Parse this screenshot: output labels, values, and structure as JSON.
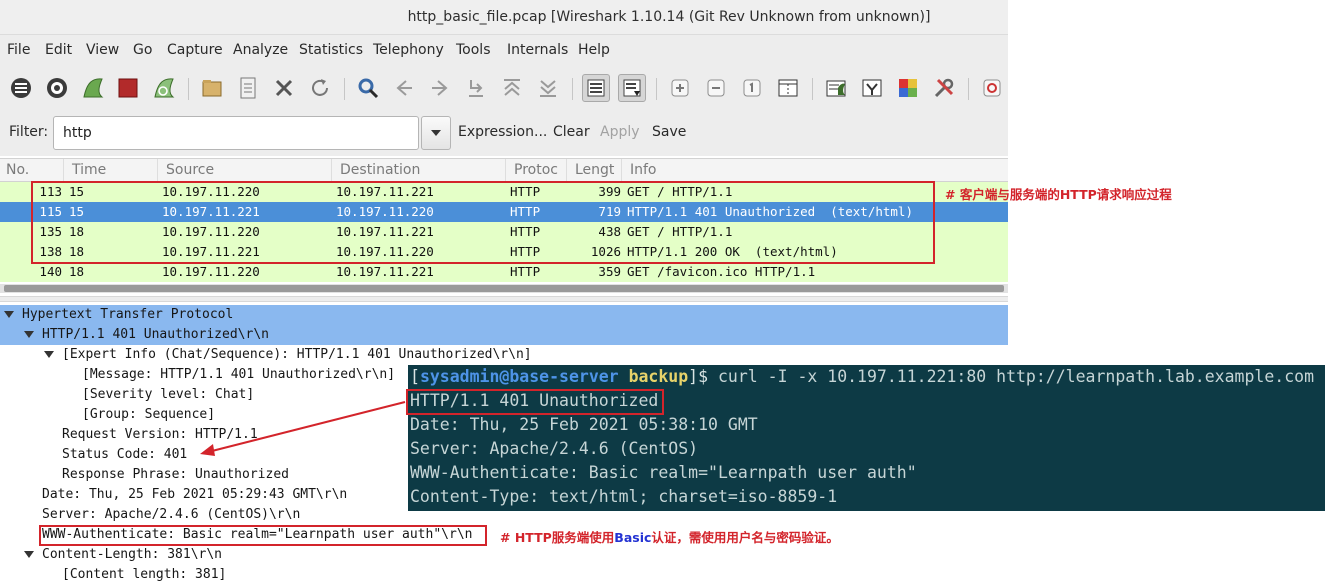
{
  "window": {
    "title": "http_basic_file.pcap  [Wireshark 1.10.14  (Git Rev Unknown from unknown)]"
  },
  "menu": [
    "File",
    "Edit",
    "View",
    "Go",
    "Capture",
    "Analyze",
    "Statistics",
    "Telephony",
    "Tools",
    "Internals",
    "Help"
  ],
  "toolbar": {
    "icons": [
      "interfaces-icon",
      "options-icon",
      "start-capture-icon",
      "stop-capture-icon",
      "restart-capture-icon",
      "open-icon",
      "save-icon",
      "close-icon",
      "reload-icon",
      "find-icon",
      "back-icon",
      "forward-icon",
      "goto-icon",
      "first-icon",
      "last-icon",
      "colorize-icon",
      "autoscroll-icon",
      "zoom-in-icon",
      "zoom-out-icon",
      "normal-size-icon",
      "resize-columns-icon",
      "capture-filters-icon",
      "display-filters-icon",
      "coloring-rules-icon",
      "preferences-icon",
      "help-icon"
    ]
  },
  "filter": {
    "label": "Filter:",
    "value": "http",
    "buttons": {
      "expression": "Expression...",
      "clear": "Clear",
      "apply": "Apply",
      "save": "Save"
    }
  },
  "packet_list": {
    "columns": [
      "No.",
      "Time",
      "Source",
      "Destination",
      "Protocol",
      "Length",
      "Info"
    ],
    "column_display": [
      "No.",
      "Time",
      "Source",
      "Destination",
      "Protoc",
      "Lengt",
      "Info"
    ],
    "rows": [
      {
        "no": "113",
        "time": "15",
        "src": "10.197.11.220",
        "dst": "10.197.11.221",
        "proto": "HTTP",
        "len": "399",
        "info": "GET / HTTP/1.1",
        "selected": false
      },
      {
        "no": "115",
        "time": "15",
        "src": "10.197.11.221",
        "dst": "10.197.11.220",
        "proto": "HTTP",
        "len": "719",
        "info": "HTTP/1.1 401 Unauthorized  (text/html)",
        "selected": true
      },
      {
        "no": "135",
        "time": "18",
        "src": "10.197.11.220",
        "dst": "10.197.11.221",
        "proto": "HTTP",
        "len": "438",
        "info": "GET / HTTP/1.1",
        "selected": false
      },
      {
        "no": "138",
        "time": "18",
        "src": "10.197.11.221",
        "dst": "10.197.11.220",
        "proto": "HTTP",
        "len": "1026",
        "info": "HTTP/1.1 200 OK  (text/html)",
        "selected": false
      },
      {
        "no": "140",
        "time": "18",
        "src": "10.197.11.220",
        "dst": "10.197.11.221",
        "proto": "HTTP",
        "len": "359",
        "info": "GET /favicon.ico HTTP/1.1",
        "selected": false
      }
    ]
  },
  "details": {
    "rows": [
      {
        "indent": 0,
        "expanded": true,
        "text": "Hypertext Transfer Protocol",
        "highlight": true
      },
      {
        "indent": 1,
        "expanded": true,
        "text": "HTTP/1.1 401 Unauthorized\\r\\n",
        "highlight": true
      },
      {
        "indent": 2,
        "expanded": true,
        "text": "[Expert Info (Chat/Sequence): HTTP/1.1 401 Unauthorized\\r\\n]",
        "highlight": false
      },
      {
        "indent": 3,
        "expanded": null,
        "text": "[Message: HTTP/1.1 401 Unauthorized\\r\\n]",
        "highlight": false
      },
      {
        "indent": 3,
        "expanded": null,
        "text": "[Severity level: Chat]",
        "highlight": false
      },
      {
        "indent": 3,
        "expanded": null,
        "text": "[Group: Sequence]",
        "highlight": false
      },
      {
        "indent": 2,
        "expanded": null,
        "text": "Request Version: HTTP/1.1",
        "highlight": false
      },
      {
        "indent": 2,
        "expanded": null,
        "text": "Status Code: 401",
        "highlight": false
      },
      {
        "indent": 2,
        "expanded": null,
        "text": "Response Phrase: Unauthorized",
        "highlight": false
      },
      {
        "indent": 1,
        "expanded": null,
        "text": "Date: Thu, 25 Feb 2021 05:29:43 GMT\\r\\n",
        "highlight": false
      },
      {
        "indent": 1,
        "expanded": null,
        "text": "Server: Apache/2.4.6 (CentOS)\\r\\n",
        "highlight": false
      },
      {
        "indent": 1,
        "expanded": null,
        "text": "WWW-Authenticate: Basic realm=\"Learnpath user auth\"\\r\\n",
        "highlight": false
      },
      {
        "indent": 1,
        "expanded": true,
        "text": "Content-Length: 381\\r\\n",
        "highlight": false
      },
      {
        "indent": 2,
        "expanded": null,
        "text": "[Content length: 381]",
        "highlight": false
      }
    ]
  },
  "terminal": {
    "prompt_open": "[",
    "prompt_user": "sysadmin@base-server",
    "prompt_dir": "backup",
    "prompt_close": "]$ ",
    "command": "curl -I -x 10.197.11.221:80 http://learnpath.lab.example.com",
    "output": [
      "HTTP/1.1 401 Unauthorized",
      "Date: Thu, 25 Feb 2021 05:38:10 GMT",
      "Server: Apache/2.4.6 (CentOS)",
      "WWW-Authenticate: Basic realm=\"Learnpath user auth\"",
      "Content-Type: text/html; charset=iso-8859-1"
    ]
  },
  "annotations": {
    "note1": "# 客户端与服务端的HTTP请求响应过程",
    "note2_a": "# HTTP服务端使用",
    "note2_b": "Basic",
    "note2_c": "认证，需使用用户名与密码验证。"
  },
  "colors": {
    "row_green": "#e4ffc7",
    "row_selected": "#4b8fd8",
    "tree_highlight": "#8ab8ef",
    "terminal_bg": "#0d3a45",
    "annotation_red": "#d3242b"
  }
}
